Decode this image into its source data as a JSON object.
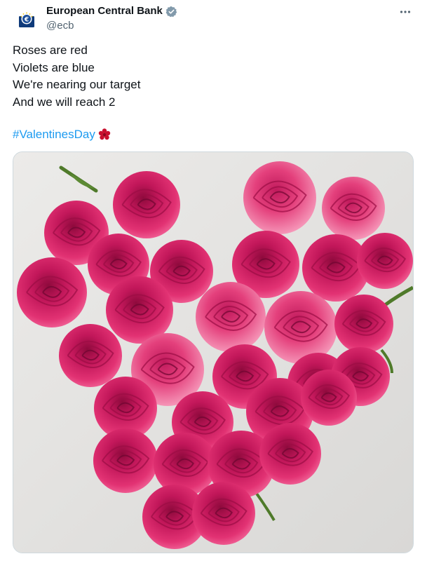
{
  "account": {
    "name": "European Central Bank",
    "handle": "@ecb",
    "verified": true,
    "avatar_icon": "ecb-euro-logo"
  },
  "tweet": {
    "lines": [
      "Roses are red",
      "Violets are blue",
      "We're nearing our target",
      "And we will reach 2"
    ],
    "hashtag": "#ValentinesDay",
    "emoji": "red-rose-emoji"
  },
  "media": {
    "alt": "Heart-shaped bouquet of pink roses",
    "subject": "rose-heart-bouquet"
  },
  "colors": {
    "accent": "#1d9bf0",
    "rose_dark": "#b80f4f",
    "rose_mid": "#e0306f",
    "rose_light": "#f27aa4",
    "background": "#e4e4e2"
  }
}
